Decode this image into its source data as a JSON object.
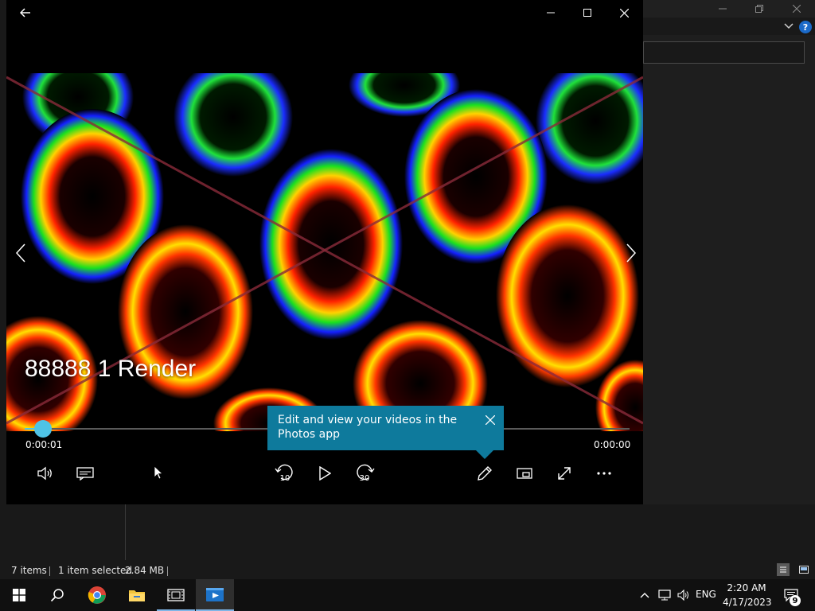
{
  "player": {
    "video_title": "88888 1 Render",
    "time_elapsed": "0:00:01",
    "time_remaining": "0:00:00",
    "seek_progress_percent": 3,
    "skip_back_seconds": "10",
    "skip_forward_seconds": "30",
    "tooltip_text": "Edit and view your videos in the Photos app",
    "accent_color": "#4fc3e6",
    "tooltip_color": "#0e7a9c"
  },
  "explorer_status": {
    "item_count": "7 items",
    "selection": "1 item selected",
    "size": "2.84 MB"
  },
  "taskbar": {
    "language": "ENG",
    "time": "2:20 AM",
    "date": "4/17/2023",
    "notification_count": "9"
  },
  "icons": {
    "back": "arrow-left-icon",
    "minimize": "minimize-icon",
    "maximize": "maximize-icon",
    "close": "close-icon",
    "previous": "chevron-left-icon",
    "next": "chevron-right-icon",
    "volume": "speaker-icon",
    "captions": "captions-icon",
    "skip_back": "rewind-10-icon",
    "play": "play-icon",
    "skip_forward": "forward-30-icon",
    "edit": "pencil-icon",
    "mini_view": "mini-view-icon",
    "fullscreen": "expand-icon",
    "more": "ellipsis-icon",
    "start": "windows-logo-icon",
    "search": "search-icon",
    "chrome": "chrome-icon",
    "file_explorer": "folder-icon",
    "movies_tv": "film-icon"
  }
}
